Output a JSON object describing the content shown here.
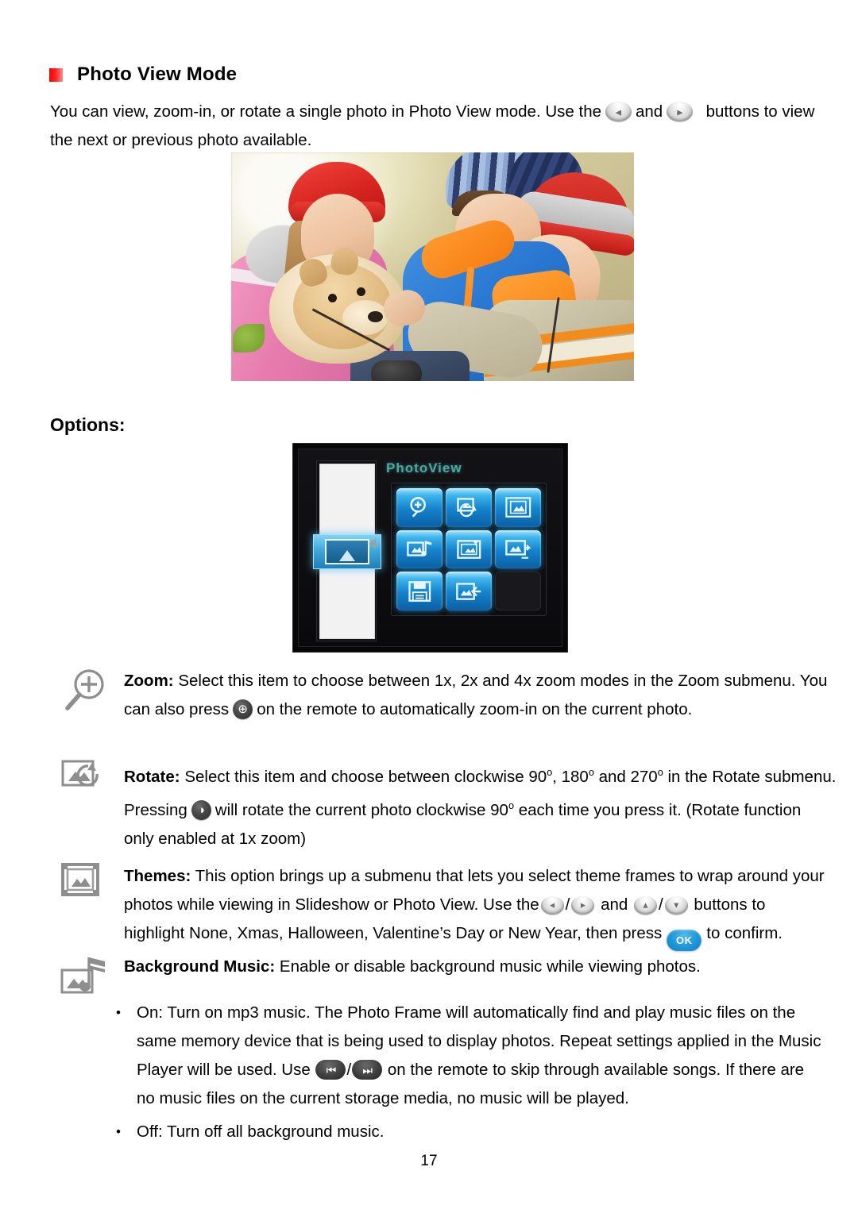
{
  "document": {
    "heading": "Photo View Mode",
    "page_number": "17",
    "options_label": "Options:"
  },
  "intro": {
    "line1_a": "You can view, zoom-in, or rotate a single photo in Photo View mode. Use the",
    "line1_b": "and",
    "line1_c": "buttons to view",
    "line2": "the next or previous photo available."
  },
  "buttons": {
    "prev": "◂",
    "next": "▸",
    "up": "▴",
    "down": "▾",
    "ok_label": "OK",
    "zoom_glyph": "⊕",
    "rotate_glyph": "◑",
    "skip_back": "⏮",
    "skip_forward": "⏭",
    "accent_blue": "#1e96da",
    "silver": "#d9d9d9"
  },
  "device_ui": {
    "title": "PhotoView",
    "title_color": "#4fa8a0",
    "icon_color": "#1584cc",
    "grid_icons": [
      "zoom-icon",
      "rotate-icon",
      "themes-icon",
      "background-music-icon",
      "photo-info-icon",
      "slideshow-icon",
      "save-icon",
      "exit-icon",
      "empty-slot"
    ],
    "selected_thumbnail": "photo-thumbnail"
  },
  "options": [
    {
      "id": "zoom",
      "icon": "magnifier-plus-icon",
      "title": "Zoom:",
      "line1": "Select this item to choose between 1x, 2x and 4x zoom modes in the Zoom submenu. You",
      "line2_a": "can also press",
      "line2_b": "on the remote to automatically zoom-in on the current photo."
    },
    {
      "id": "rotate",
      "icon": "photo-rotate-icon",
      "title": "Rotate:",
      "line1_a": "Select this item and choose between clockwise 90",
      "line1_b": ", 180",
      "line1_c": "and 270",
      "line1_d": "in the Rotate submenu.",
      "line2_a": "Pressing",
      "line2_b": "will rotate the current photo clockwise 90",
      "line2_c": "each time you press it. (Rotate function",
      "line3": "only enabled at 1x zoom)"
    },
    {
      "id": "themes",
      "icon": "theme-frame-icon",
      "title": "Themes:",
      "line1": "This option brings up a submenu that lets you select theme frames to wrap around your",
      "line2_a": "photos while viewing in Slideshow or Photo View. Use the",
      "line2_b": "and",
      "line2_c": "buttons to",
      "line3_a": "highlight None, Xmas, Halloween, Valentine’s Day or New Year, then press",
      "line3_b": "to confirm."
    },
    {
      "id": "background-music",
      "icon": "photo-music-icon",
      "title": "Background Music:",
      "line1": "Enable or disable background music while viewing photos."
    }
  ],
  "bullets": [
    {
      "marker": "•",
      "line1": "On: Turn on mp3 music. The Photo Frame will automatically find and play music files on the",
      "line2": "same memory device that is being used to display photos. Repeat settings applied in the Music",
      "line3_a": "Player will be used. Use",
      "line3_b": "on the remote to skip through available songs. If there are",
      "line4": "no music files on the current storage media, no music will be played."
    },
    {
      "marker": "•",
      "line1": "Off: Turn off all background music."
    }
  ],
  "photo": {
    "description": "three-children-with-puppy-photo"
  }
}
